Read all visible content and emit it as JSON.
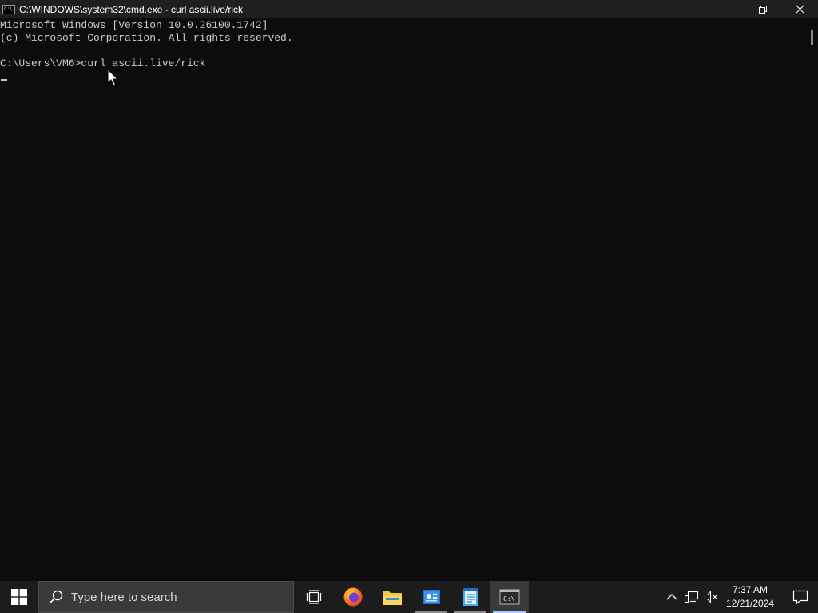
{
  "window": {
    "title": "C:\\WINDOWS\\system32\\cmd.exe - curl  ascii.live/rick",
    "icon_label": "C:\\"
  },
  "console": {
    "lines": [
      "Microsoft Windows [Version 10.0.26100.1742]",
      "(c) Microsoft Corporation. All rights reserved.",
      "",
      "C:\\Users\\VM6>curl ascii.live/rick"
    ],
    "text_color": "#cccccc",
    "background": "#0c0c0c"
  },
  "taskbar": {
    "search_placeholder": "Type here to search",
    "apps": [
      {
        "name": "task-view-icon"
      },
      {
        "name": "firefox-icon"
      },
      {
        "name": "file-explorer-icon"
      },
      {
        "name": "control-panel-icon"
      },
      {
        "name": "notepad-icon"
      },
      {
        "name": "command-prompt-icon",
        "label": "C:\\"
      }
    ],
    "clock": {
      "time": "7:37 AM",
      "date": "12/21/2024"
    }
  },
  "colors": {
    "accent": "#a8c7fa",
    "taskbar": "#1c1c1c",
    "titlebar": "#1f1f1f"
  }
}
